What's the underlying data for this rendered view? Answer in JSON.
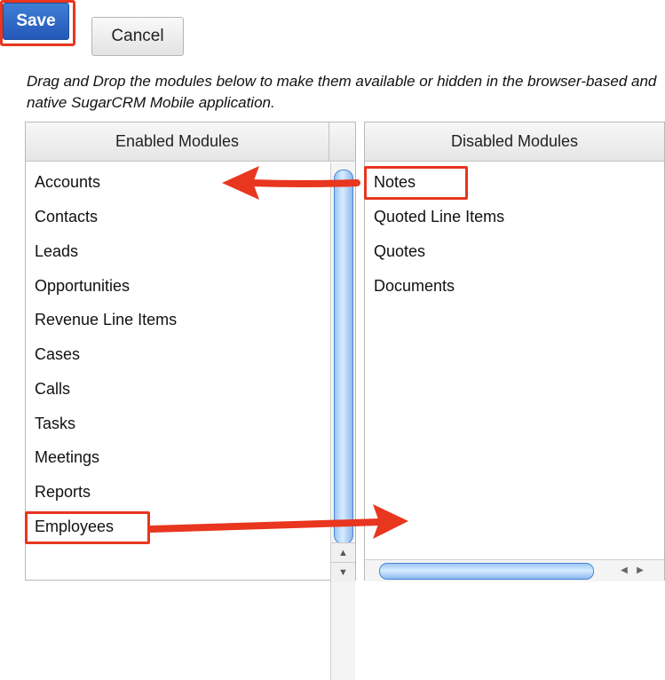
{
  "toolbar": {
    "save_label": "Save",
    "cancel_label": "Cancel"
  },
  "instructions": "Drag and Drop the modules below to make them available or hidden in the browser-based and native SugarCRM Mobile application.",
  "enabled": {
    "header": "Enabled Modules",
    "items": [
      "Accounts",
      "Contacts",
      "Leads",
      "Opportunities",
      "Revenue Line Items",
      "Cases",
      "Calls",
      "Tasks",
      "Meetings",
      "Reports",
      "Employees"
    ]
  },
  "disabled": {
    "header": "Disabled Modules",
    "items": [
      "Notes",
      "Quoted Line Items",
      "Quotes",
      "Documents"
    ]
  },
  "icons": {
    "scroll_up": "scroll-up-arrow-icon",
    "scroll_down": "scroll-down-arrow-icon",
    "scroll_left": "scroll-left-arrow-icon",
    "scroll_right": "scroll-right-arrow-icon",
    "annotation_arrow": "red-arrow-icon"
  },
  "colors": {
    "save_button": "#2f6bc8",
    "highlight": "#e8361f",
    "scrollbar_thumb": "#a8cdf6"
  }
}
